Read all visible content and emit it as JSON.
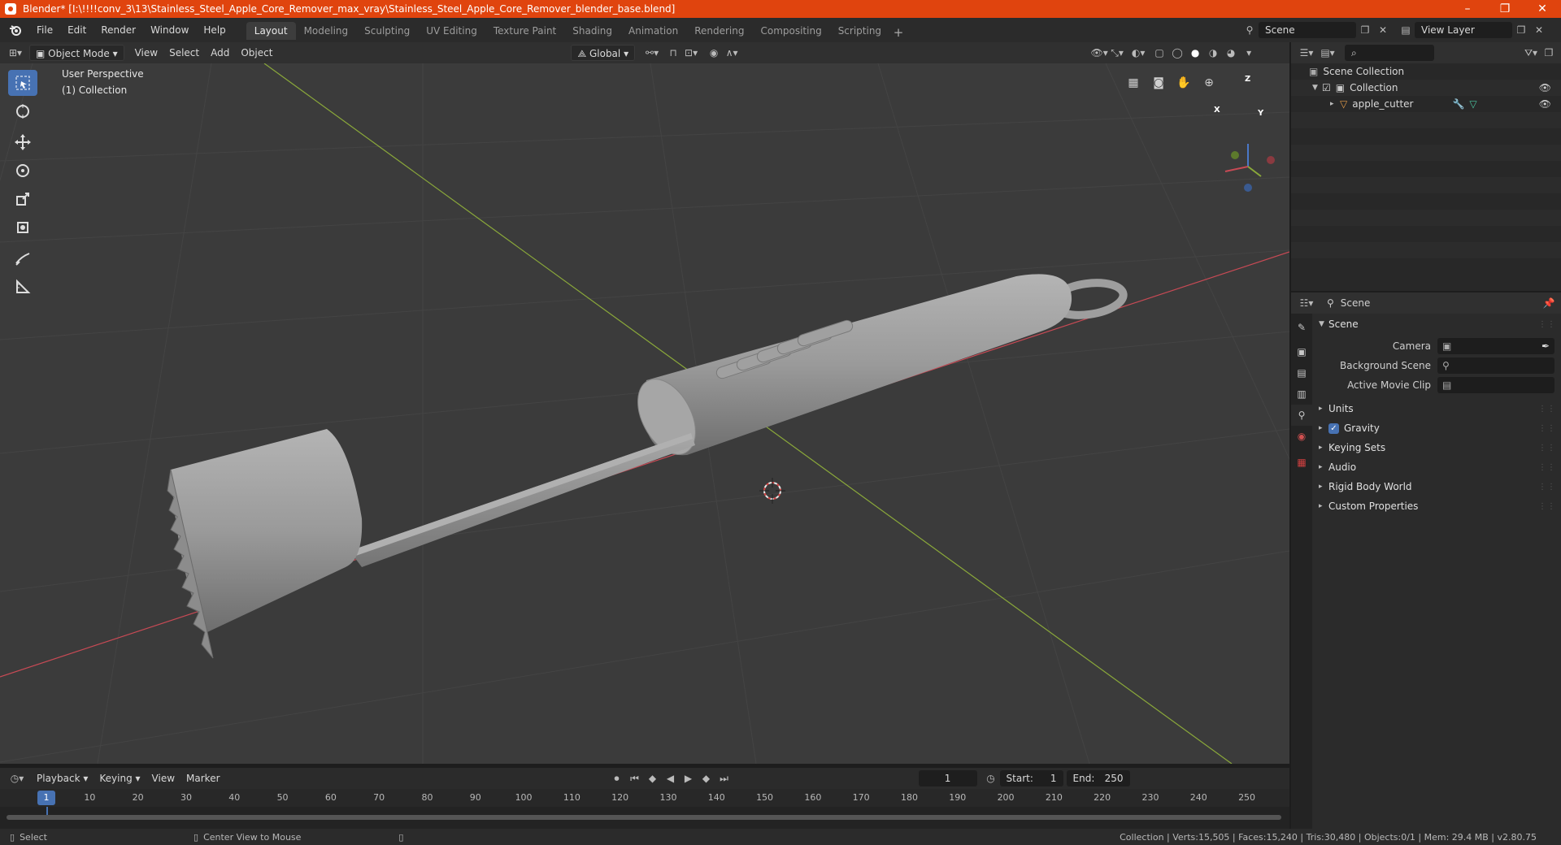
{
  "window": {
    "title": "Blender* [I:\\!!!!conv_3\\13\\Stainless_Steel_Apple_Core_Remover_max_vray\\Stainless_Steel_Apple_Core_Remover_blender_base.blend]",
    "minimize": "–",
    "restore": "❐",
    "close": "✕"
  },
  "menu": [
    "File",
    "Edit",
    "Render",
    "Window",
    "Help"
  ],
  "workspaces": [
    "Layout",
    "Modeling",
    "Sculpting",
    "UV Editing",
    "Texture Paint",
    "Shading",
    "Animation",
    "Rendering",
    "Compositing",
    "Scripting"
  ],
  "scene_selector": {
    "scene": "Scene",
    "view_layer": "View Layer"
  },
  "viewport_header": {
    "mode": "Object Mode",
    "menus": [
      "View",
      "Select",
      "Add",
      "Object"
    ],
    "transform": "Global"
  },
  "viewport": {
    "perspective": "User Perspective",
    "collection": "(1) Collection",
    "gizmo": {
      "x": "X",
      "y": "Y",
      "z": "Z"
    },
    "colors": {
      "x_axis": "#c84a55",
      "y_axis": "#8aa83a",
      "background": "#3b3b3b",
      "grid": "#444444"
    }
  },
  "outliner": {
    "search_placeholder": "",
    "root": "Scene Collection",
    "collection": "Collection",
    "object": "apple_cutter"
  },
  "properties": {
    "context": "Scene",
    "panel": "Scene",
    "fields": [
      {
        "label": "Camera"
      },
      {
        "label": "Background Scene"
      },
      {
        "label": "Active Movie Clip"
      }
    ],
    "sections": [
      "Units",
      "Gravity",
      "Keying Sets",
      "Audio",
      "Rigid Body World",
      "Custom Properties"
    ]
  },
  "timeline": {
    "menus": [
      "Playback",
      "Keying",
      "View",
      "Marker"
    ],
    "current_frame": "1",
    "start_label": "Start:",
    "start": "1",
    "end_label": "End:",
    "end": "250",
    "ticks": [
      "10",
      "20",
      "30",
      "40",
      "50",
      "60",
      "70",
      "80",
      "90",
      "100",
      "110",
      "120",
      "130",
      "140",
      "150",
      "160",
      "170",
      "180",
      "190",
      "200",
      "210",
      "220",
      "230",
      "240",
      "250"
    ]
  },
  "statusbar": {
    "left_action": "Select",
    "middle_action": "Center View to Mouse",
    "stats": "Collection | Verts:15,505 | Faces:15,240 | Tris:30,480 | Objects:0/1 | Mem: 29.4 MB | v2.80.75"
  }
}
